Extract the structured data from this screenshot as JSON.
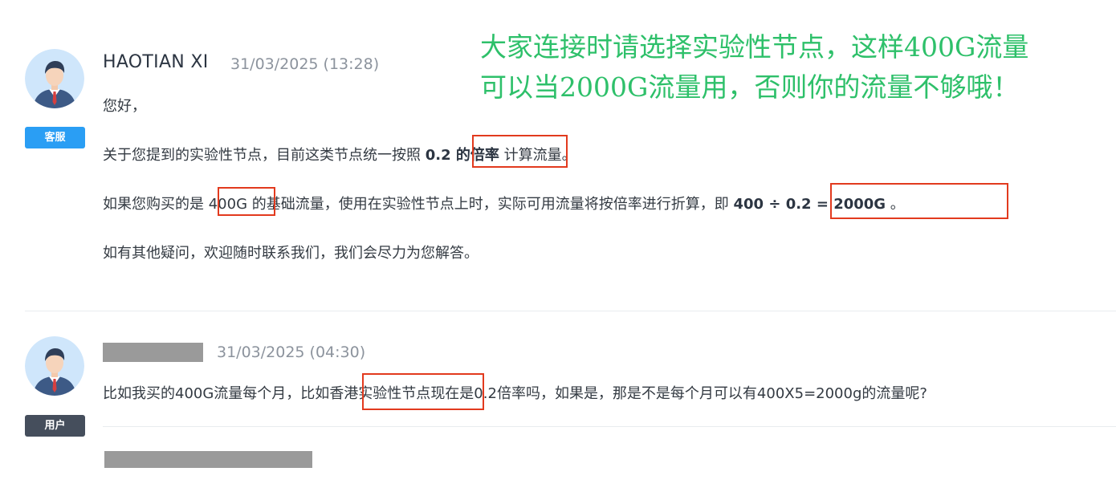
{
  "colors": {
    "staff_badge": "#2a9ef4",
    "user_badge": "#454e5c",
    "highlight_box": "#e23a1e",
    "annotation_text": "#2ec06a"
  },
  "annotation": {
    "line1": "大家连接时请选择实验性节点，这样400G流量",
    "line2": "可以当2000G流量用，否则你的流量不够哦！"
  },
  "messages": [
    {
      "author": "HAOTIAN XI",
      "timestamp": "31/03/2025 (13:28)",
      "role": "客服",
      "avatar_icon": "support-agent-avatar-icon",
      "greeting": "您好，",
      "p1_before": "关于您提到的实验性节点，目前这类节点统一按照 ",
      "p1_bold": "0.2 的倍率",
      "p1_after": " 计算流量。",
      "p2_before": "如果您购买的是 ",
      "p2_mid1": "400G",
      "p2_mid2": " 的基础流量，使用在实验性节点上时，实际可用流量将按倍率进行折算，即 ",
      "p2_bold": "400 ÷ 0.2 = 2000G",
      "p2_after": " 。",
      "p3": "如有其他疑问，欢迎随时联系我们，我们会尽力为您解答。"
    },
    {
      "author": "",
      "timestamp": "31/03/2025 (04:30)",
      "role": "用户",
      "avatar_icon": "user-avatar-icon",
      "text_before": "比如我买的400G流量每个月，比如",
      "text_hl": "香港实验性节点",
      "text_after": "现在是0.2倍率吗，如果是，那是不是每个月可以有400X5=2000g的流量呢?"
    }
  ]
}
